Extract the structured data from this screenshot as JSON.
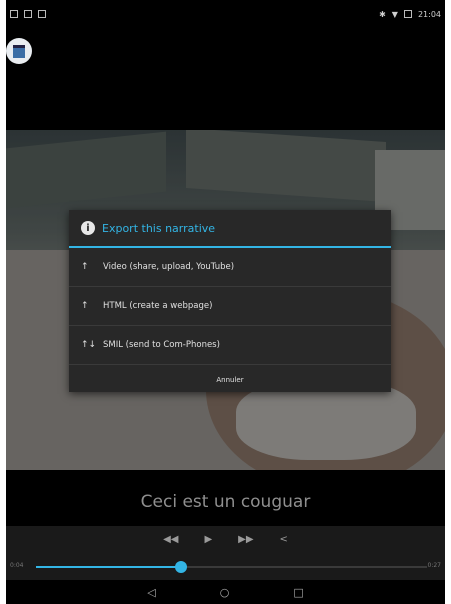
{
  "statusbar": {
    "time": "21:04",
    "left_icons": [
      "notification-icon",
      "sd-card-icon",
      "camera-icon"
    ],
    "right_icons": [
      "bluetooth-icon",
      "wifi-icon",
      "battery-icon"
    ]
  },
  "dialog": {
    "title": "Export this narrative",
    "items": [
      {
        "arrows": "↑",
        "label": "Video (share, upload, YouTube)"
      },
      {
        "arrows": "↑",
        "label": "HTML (create a webpage)"
      },
      {
        "arrows": "↑↓",
        "label": "SMIL (send to Com-Phones)"
      }
    ],
    "cancel_label": "Annuler"
  },
  "caption": "Ceci est un couguar",
  "player": {
    "elapsed": "0:04",
    "duration": "0:27",
    "progress": 0.37,
    "rewind_glyph": "◀◀",
    "play_glyph": "▶",
    "forward_glyph": "▶▶",
    "share_glyph": "<"
  },
  "nav": {
    "back_glyph": "◁",
    "home_glyph": "○",
    "recents_glyph": "□"
  },
  "colors": {
    "accent": "#33b5e5",
    "dialog_bg": "#282828"
  }
}
